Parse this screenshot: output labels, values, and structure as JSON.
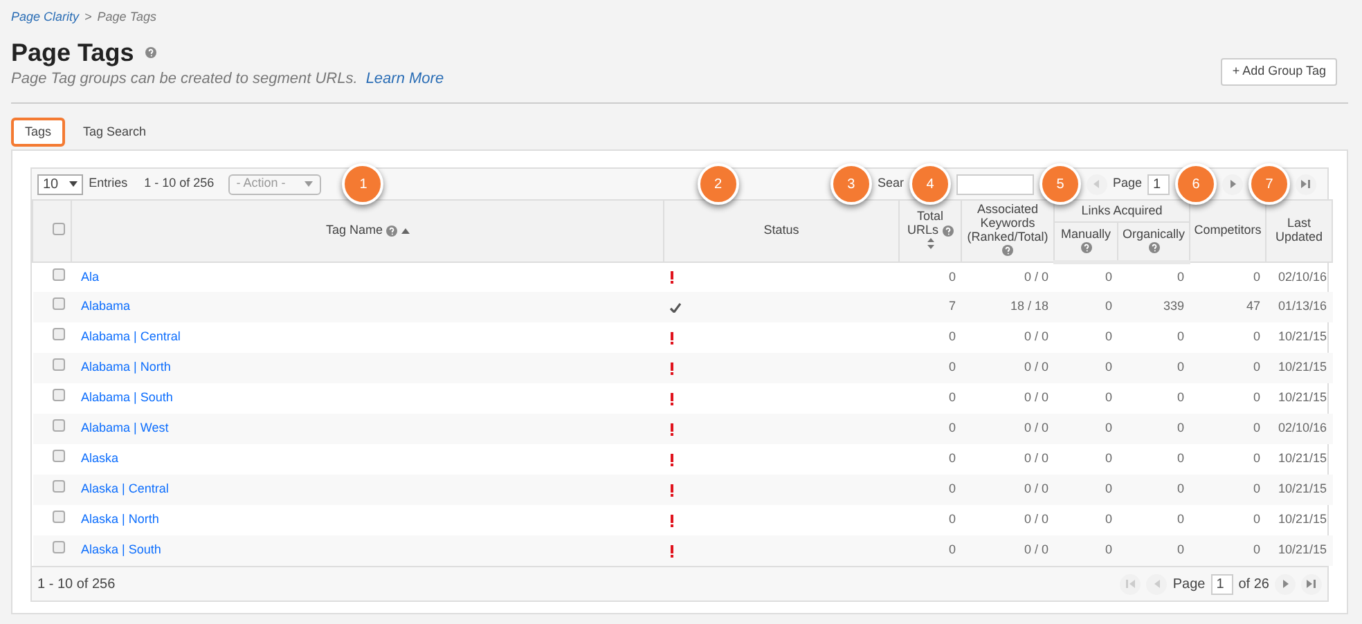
{
  "breadcrumb": {
    "items": [
      "Page Clarity",
      "Page Tags"
    ],
    "separator": ">"
  },
  "title": "Page Tags",
  "subtitle": "Page Tag groups can be created to segment URLs.",
  "learn_more": "Learn More",
  "add_button": "+ Add Group Tag",
  "tabs": [
    {
      "label": "Tags",
      "selected": true
    },
    {
      "label": "Tag Search",
      "selected": false
    }
  ],
  "select_all_checked": false,
  "toolbar": {
    "page_size": "10",
    "entries_label": "Entries",
    "range": "1 - 10 of 256",
    "action_placeholder": "- Action -",
    "search_label": "Sear",
    "page_label": "Page",
    "page_value": "1"
  },
  "columns": {
    "tag_name": "Tag Name",
    "status": "Status",
    "total_urls": "Total URLs",
    "keywords": "Associated Keywords (Ranked/Total)",
    "links_group": "Links Acquired",
    "manually": "Manually",
    "organically": "Organically",
    "competitors": "Competitors",
    "last_updated": "Last Updated"
  },
  "rows": [
    {
      "checked": false,
      "name": "Ala",
      "ok": false,
      "total_urls": "0",
      "keywords": "0 / 0",
      "manually": "0",
      "organically": "0",
      "competitors": "0",
      "last_updated": "02/10/16"
    },
    {
      "checked": false,
      "name": "Alabama",
      "ok": true,
      "total_urls": "7",
      "keywords": "18 / 18",
      "manually": "0",
      "organically": "339",
      "competitors": "47",
      "last_updated": "01/13/16"
    },
    {
      "checked": false,
      "name": "Alabama | Central",
      "ok": false,
      "total_urls": "0",
      "keywords": "0 / 0",
      "manually": "0",
      "organically": "0",
      "competitors": "0",
      "last_updated": "10/21/15"
    },
    {
      "checked": false,
      "name": "Alabama | North",
      "ok": false,
      "total_urls": "0",
      "keywords": "0 / 0",
      "manually": "0",
      "organically": "0",
      "competitors": "0",
      "last_updated": "10/21/15"
    },
    {
      "checked": false,
      "name": "Alabama | South",
      "ok": false,
      "total_urls": "0",
      "keywords": "0 / 0",
      "manually": "0",
      "organically": "0",
      "competitors": "0",
      "last_updated": "10/21/15"
    },
    {
      "checked": false,
      "name": "Alabama | West",
      "ok": false,
      "total_urls": "0",
      "keywords": "0 / 0",
      "manually": "0",
      "organically": "0",
      "competitors": "0",
      "last_updated": "02/10/16"
    },
    {
      "checked": false,
      "name": "Alaska",
      "ok": false,
      "total_urls": "0",
      "keywords": "0 / 0",
      "manually": "0",
      "organically": "0",
      "competitors": "0",
      "last_updated": "10/21/15"
    },
    {
      "checked": false,
      "name": "Alaska | Central",
      "ok": false,
      "total_urls": "0",
      "keywords": "0 / 0",
      "manually": "0",
      "organically": "0",
      "competitors": "0",
      "last_updated": "10/21/15"
    },
    {
      "checked": false,
      "name": "Alaska | North",
      "ok": false,
      "total_urls": "0",
      "keywords": "0 / 0",
      "manually": "0",
      "organically": "0",
      "competitors": "0",
      "last_updated": "10/21/15"
    },
    {
      "checked": false,
      "name": "Alaska | South",
      "ok": false,
      "total_urls": "0",
      "keywords": "0 / 0",
      "manually": "0",
      "organically": "0",
      "competitors": "0",
      "last_updated": "10/21/15"
    }
  ],
  "footer": {
    "range": "1 - 10 of 256",
    "page_label": "Page",
    "page_value": "1",
    "page_total": "of 26"
  },
  "callouts": [
    "1",
    "2",
    "3",
    "4",
    "5",
    "6",
    "7"
  ]
}
